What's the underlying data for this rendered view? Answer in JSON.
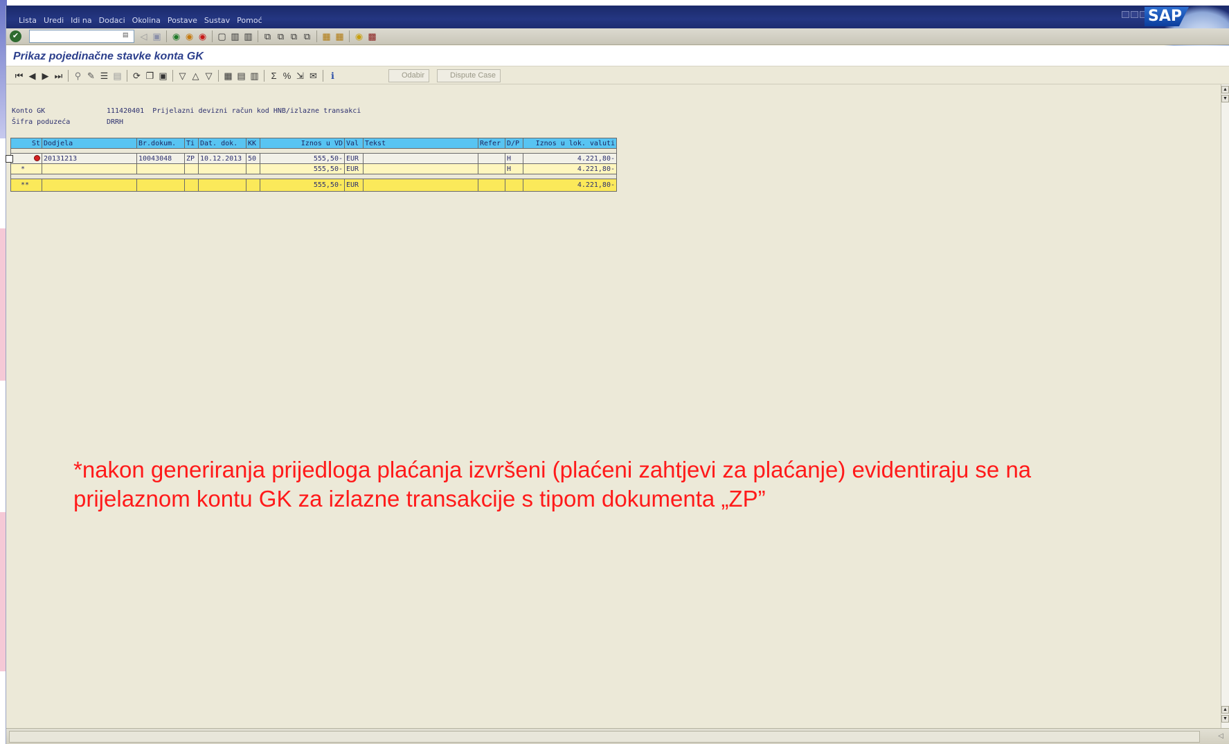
{
  "menu": {
    "items": [
      "Lista",
      "Uredi",
      "Idi na",
      "Dodaci",
      "Okolina",
      "Postave",
      "Sustav",
      "Pomoć"
    ]
  },
  "logo": "SAP",
  "command_field": {
    "value": ""
  },
  "title": "Prikaz pojedinačne stavke konta GK",
  "app_toolbar": {
    "select_label": "Odabir",
    "dispute_label": "Dispute Case"
  },
  "header": {
    "konto_label": "Konto GK",
    "konto_value": "111420401",
    "konto_desc": "Prijelazni devizni račun kod HNB/izlazne transakci",
    "sifra_label": "Šifra poduzeća",
    "sifra_value": "DRRH"
  },
  "table": {
    "columns": [
      "St",
      "Dodjela",
      "Br.dokum.",
      "Ti",
      "Dat. dok.",
      "KK",
      "Iznos u VD",
      "Val",
      "Tekst",
      "Refer",
      "D/P",
      "Iznos u lok. valuti"
    ],
    "rows": [
      {
        "st": "",
        "dodjela": "20131213",
        "brdok": "10043048",
        "ti": "ZP",
        "datum": "10.12.2013",
        "kk": "50",
        "iznos_vd": "555,50-",
        "val": "EUR",
        "tekst": "",
        "refer": "",
        "dp": "H",
        "iznos_lok": "4.221,80-"
      }
    ],
    "subtotal": {
      "marker": "*",
      "iznos_vd": "555,50-",
      "val": "EUR",
      "dp": "H",
      "iznos_lok": "4.221,80-"
    },
    "total": {
      "marker": "**",
      "iznos_vd": "555,50-",
      "val": "EUR",
      "iznos_lok": "4.221,80-"
    }
  },
  "annotation": {
    "line1": "*nakon generiranja prijedloga plaćanja izvršeni (plaćeni zahtjevi za plaćanje) evidentiraju se na",
    "line2": "prijelaznom kontu GK za izlazne transakcije s tipom dokumenta „ZP”"
  },
  "status": {
    "text": ""
  },
  "colors": {
    "menubar": "#243682",
    "title": "#2c3f8c",
    "table_header": "#58c4f2",
    "subtotal_row": "#fef6bd",
    "total_row": "#fbe95a",
    "annotation": "#ff1a1a"
  }
}
